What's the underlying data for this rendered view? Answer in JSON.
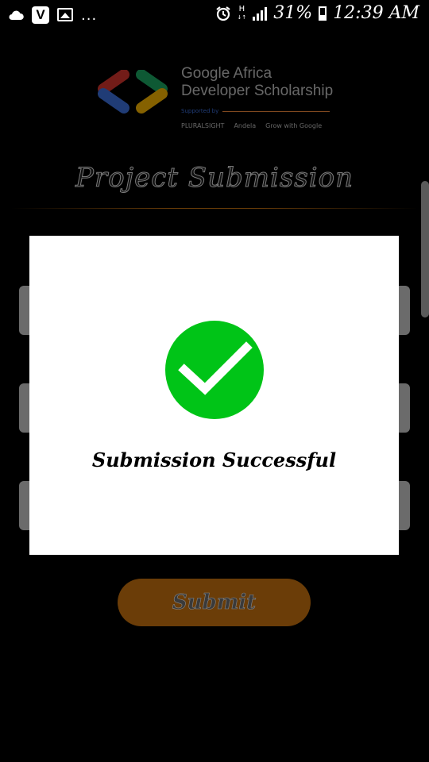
{
  "status_bar": {
    "left_icons": [
      "cloud-icon",
      "v-app-icon",
      "image-icon",
      "more-dots"
    ],
    "v_badge": "V",
    "more": "...",
    "network_type": "H",
    "battery": "31%",
    "time": "12:39 AM"
  },
  "logo": {
    "line1": "Google Africa",
    "line2": "Developer Scholarship",
    "supported_by": "Supported by",
    "partners": [
      "PLURALSIGHT",
      "Andela",
      "Grow with Google"
    ]
  },
  "page_title": "Project Submission",
  "submit_label": "Submit",
  "dialog": {
    "icon": "checkmark-icon",
    "message": "Submission Successful",
    "accent_color": "#00c417"
  },
  "colors": {
    "button": "#6b3d08",
    "dialog_bg": "#ffffff"
  }
}
